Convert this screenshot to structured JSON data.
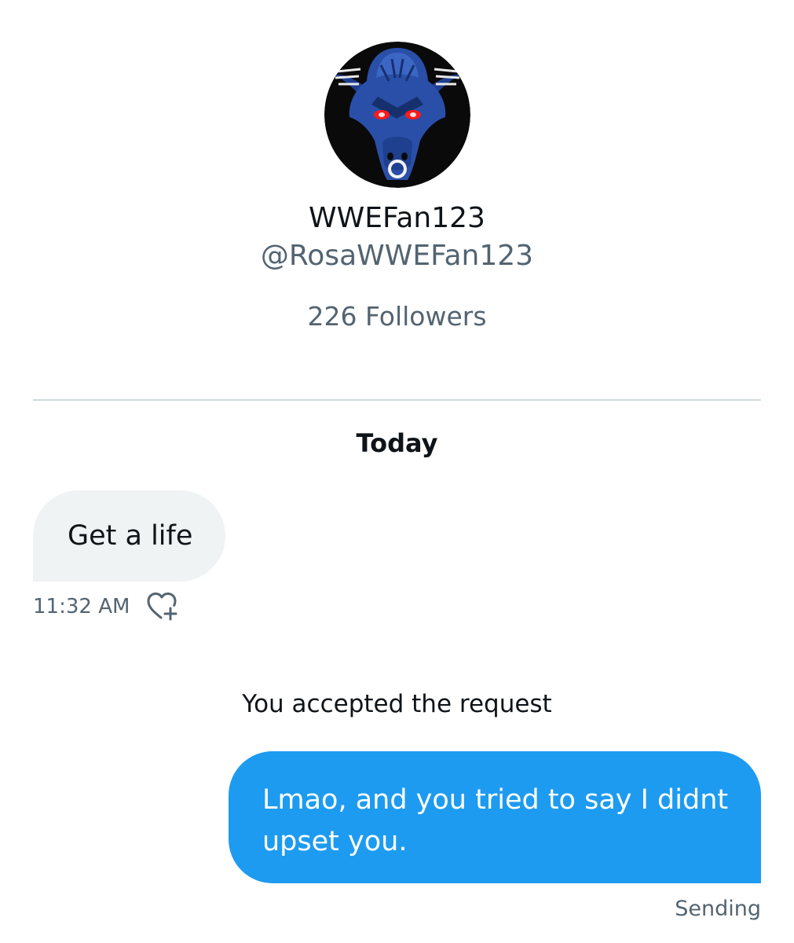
{
  "profile": {
    "display_name": "WWEFan123",
    "handle": "@RosaWWEFan123",
    "followers": "226 Followers",
    "avatar_icon": "blue-bull-head-icon"
  },
  "conversation": {
    "day_label": "Today",
    "messages": [
      {
        "direction": "incoming",
        "text": "Get a life",
        "time": "11:32 AM",
        "reaction_icon": "add-reaction-heart-icon"
      },
      {
        "direction": "outgoing",
        "text": "Lmao, and you tried to say I didnt upset you.",
        "status": "Sending"
      }
    ],
    "system_note": "You accepted the request"
  },
  "colors": {
    "accent_blue": "#1d9bf0",
    "incoming_bubble": "#eff3f4",
    "secondary_text": "#536471",
    "primary_text": "#0f1419",
    "divider": "#cfd9de"
  }
}
